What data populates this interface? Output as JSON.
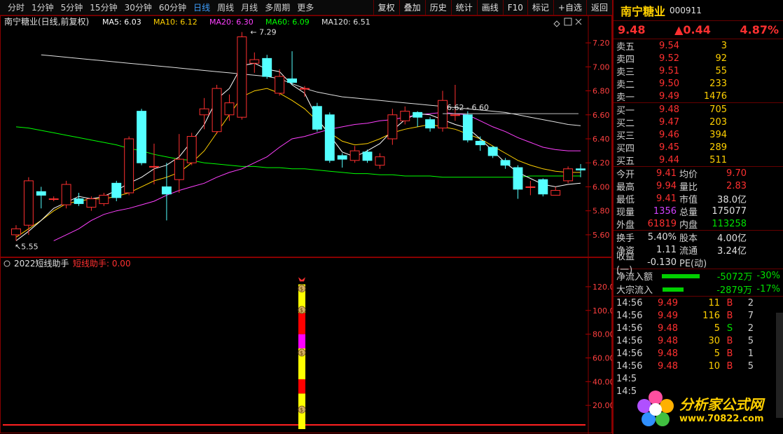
{
  "toolbar": {
    "periods": [
      "分时",
      "1分钟",
      "5分钟",
      "15分钟",
      "30分钟",
      "60分钟",
      "日线",
      "周线",
      "月线",
      "多周期",
      "更多"
    ],
    "active_period": "日线",
    "buttons": [
      "复权",
      "叠加",
      "历史",
      "统计",
      "画线",
      "F10",
      "标记",
      "+自选",
      "返回"
    ]
  },
  "main_chart": {
    "title": "南宁糖业(日线,前复权)",
    "ma_labels": [
      "MA5: 6.03",
      "MA10: 6.12",
      "MA20: 6.30",
      "MA60: 6.09",
      "MA120: 6.51"
    ],
    "ma_colors": [
      "#ffffff",
      "#ffd000",
      "#ff40ff",
      "#00ff00",
      "#e0e0e0"
    ],
    "high_label": "7.29",
    "low_label": "5.55",
    "range_label": "6.62 - 6.60",
    "y_ticks": [
      "7.20",
      "7.00",
      "6.80",
      "6.60",
      "6.40",
      "6.20",
      "6.00",
      "5.80",
      "5.60"
    ]
  },
  "sub_chart": {
    "title": "2022短线助手",
    "indicator": "短线助手: 0.00",
    "y_ticks": [
      "120.00",
      "100.00",
      "80.00",
      "60.00",
      "40.00",
      "20.00"
    ]
  },
  "chart_data": {
    "type": "candlestick",
    "ylim": [
      5.5,
      7.3
    ],
    "candles": [
      {
        "o": 5.6,
        "c": 5.65,
        "h": 5.68,
        "l": 5.55
      },
      {
        "o": 5.68,
        "c": 6.05,
        "h": 6.08,
        "l": 5.6
      },
      {
        "o": 5.96,
        "c": 5.93,
        "h": 6.0,
        "l": 5.82
      },
      {
        "o": 5.9,
        "c": 5.9,
        "h": 5.92,
        "l": 5.88
      },
      {
        "o": 5.85,
        "c": 6.02,
        "h": 6.05,
        "l": 5.82
      },
      {
        "o": 5.9,
        "c": 5.86,
        "h": 5.95,
        "l": 5.84
      },
      {
        "o": 5.83,
        "c": 5.9,
        "h": 5.92,
        "l": 5.8
      },
      {
        "o": 5.86,
        "c": 5.93,
        "h": 5.95,
        "l": 5.84
      },
      {
        "o": 6.03,
        "c": 5.91,
        "h": 6.05,
        "l": 5.88
      },
      {
        "o": 5.95,
        "c": 6.4,
        "h": 6.42,
        "l": 5.93
      },
      {
        "o": 6.63,
        "c": 6.2,
        "h": 6.65,
        "l": 6.18
      },
      {
        "o": 6.17,
        "c": 6.17,
        "h": 6.36,
        "l": 6.02
      },
      {
        "o": 6.0,
        "c": 5.94,
        "h": 6.2,
        "l": 5.72
      },
      {
        "o": 6.06,
        "c": 6.23,
        "h": 6.44,
        "l": 5.95
      },
      {
        "o": 6.2,
        "c": 6.42,
        "h": 6.45,
        "l": 6.18
      },
      {
        "o": 6.6,
        "c": 6.65,
        "h": 6.74,
        "l": 6.48
      },
      {
        "o": 6.46,
        "c": 6.82,
        "h": 6.85,
        "l": 6.44
      },
      {
        "o": 6.6,
        "c": 6.7,
        "h": 6.77,
        "l": 6.55
      },
      {
        "o": 6.58,
        "c": 7.25,
        "h": 7.29,
        "l": 6.56
      },
      {
        "o": 7.03,
        "c": 7.06,
        "h": 7.12,
        "l": 6.95
      },
      {
        "o": 7.07,
        "c": 6.92,
        "h": 7.1,
        "l": 6.9
      },
      {
        "o": 6.78,
        "c": 6.92,
        "h": 6.98,
        "l": 6.76
      },
      {
        "o": 6.9,
        "c": 6.87,
        "h": 7.13,
        "l": 6.85
      },
      {
        "o": 6.82,
        "c": 6.82,
        "h": 6.84,
        "l": 6.75
      },
      {
        "o": 6.67,
        "c": 6.48,
        "h": 6.7,
        "l": 6.46
      },
      {
        "o": 6.6,
        "c": 6.22,
        "h": 6.62,
        "l": 6.2
      },
      {
        "o": 6.26,
        "c": 6.23,
        "h": 6.28,
        "l": 6.16
      },
      {
        "o": 6.22,
        "c": 6.3,
        "h": 6.34,
        "l": 6.2
      },
      {
        "o": 6.29,
        "c": 6.22,
        "h": 6.31,
        "l": 6.2
      },
      {
        "o": 6.18,
        "c": 6.25,
        "h": 6.28,
        "l": 6.15
      },
      {
        "o": 6.4,
        "c": 6.6,
        "h": 6.65,
        "l": 6.35
      },
      {
        "o": 6.55,
        "c": 6.63,
        "h": 6.67,
        "l": 6.52
      },
      {
        "o": 6.62,
        "c": 6.58,
        "h": 6.63,
        "l": 6.5
      },
      {
        "o": 6.56,
        "c": 6.49,
        "h": 6.58,
        "l": 6.46
      },
      {
        "o": 6.49,
        "c": 6.72,
        "h": 6.8,
        "l": 6.46
      },
      {
        "o": 6.6,
        "c": 6.6,
        "h": 6.85,
        "l": 6.55
      },
      {
        "o": 6.6,
        "c": 6.39,
        "h": 6.63,
        "l": 6.37
      },
      {
        "o": 6.38,
        "c": 6.35,
        "h": 6.42,
        "l": 6.3
      },
      {
        "o": 6.33,
        "c": 6.26,
        "h": 6.34,
        "l": 6.24
      },
      {
        "o": 6.22,
        "c": 6.18,
        "h": 6.24,
        "l": 6.15
      },
      {
        "o": 6.16,
        "c": 5.98,
        "h": 6.18,
        "l": 5.9
      },
      {
        "o": 6.0,
        "c": 6.0,
        "h": 6.05,
        "l": 5.93
      },
      {
        "o": 6.06,
        "c": 5.94,
        "h": 6.07,
        "l": 5.92
      },
      {
        "o": 5.93,
        "c": 5.97,
        "h": 6.0,
        "l": 5.93
      },
      {
        "o": 6.05,
        "c": 6.15,
        "h": 6.17,
        "l": 6.03
      },
      {
        "o": 6.15,
        "c": 6.14,
        "h": 6.19,
        "l": 6.08
      }
    ],
    "ma5": [
      5.55,
      5.63,
      5.72,
      5.82,
      5.87,
      5.92,
      5.9,
      5.92,
      5.97,
      6.03,
      6.08,
      6.15,
      6.18,
      6.25,
      6.38,
      6.52,
      6.73,
      6.82,
      7.01,
      7.03,
      6.98,
      6.96,
      6.85,
      6.78,
      6.57,
      6.43,
      6.29,
      6.25,
      6.3,
      6.36,
      6.47,
      6.56,
      6.61,
      6.6,
      6.56,
      6.52,
      6.49,
      6.4,
      6.3,
      6.2,
      6.12,
      6.07,
      6.02,
      6.0,
      6.02,
      6.03
    ],
    "ma10": [
      5.58,
      5.65,
      5.72,
      5.8,
      5.86,
      5.88,
      5.9,
      5.9,
      5.92,
      5.95,
      6.0,
      6.05,
      6.08,
      6.12,
      6.2,
      6.3,
      6.45,
      6.6,
      6.75,
      6.8,
      6.82,
      6.78,
      6.72,
      6.65,
      6.55,
      6.45,
      6.38,
      6.35,
      6.36,
      6.4,
      6.45,
      6.48,
      6.5,
      6.52,
      6.5,
      6.48,
      6.44,
      6.4,
      6.34,
      6.28,
      6.22,
      6.18,
      6.15,
      6.13,
      6.12,
      6.12
    ],
    "ma20": [
      5.55,
      5.6,
      5.65,
      5.72,
      5.77,
      5.8,
      5.82,
      5.85,
      5.88,
      5.93,
      5.97,
      6.0,
      6.03,
      6.08,
      6.12,
      6.15,
      6.2,
      6.25,
      6.33,
      6.4,
      6.42,
      6.45,
      6.48,
      6.5,
      6.52,
      6.53,
      6.55,
      6.56,
      6.58,
      6.6,
      6.61,
      6.62,
      6.61,
      6.6,
      6.55,
      6.5,
      6.46,
      6.41,
      6.37,
      6.33,
      6.31,
      6.3,
      6.3
    ],
    "ma60": [
      6.5,
      6.49,
      6.47,
      6.45,
      6.43,
      6.41,
      6.39,
      6.37,
      6.35,
      6.32,
      6.3,
      6.27,
      6.25,
      6.23,
      6.22,
      6.2,
      6.19,
      6.18,
      6.17,
      6.17,
      6.16,
      6.16,
      6.15,
      6.15,
      6.14,
      6.13,
      6.12,
      6.11,
      6.11,
      6.1,
      6.1,
      6.09,
      6.09,
      6.09,
      6.08,
      6.08,
      6.08,
      6.08,
      6.08,
      6.08,
      6.08,
      6.09,
      6.09,
      6.09,
      6.09,
      6.09
    ],
    "ma120": [
      7.1,
      7.09,
      7.08,
      7.07,
      7.06,
      7.05,
      7.04,
      7.03,
      7.02,
      7.01,
      7.0,
      6.99,
      6.98,
      6.97,
      6.96,
      6.95,
      6.94,
      6.93,
      6.92,
      6.9,
      6.86,
      6.82,
      6.79,
      6.77,
      6.75,
      6.74,
      6.73,
      6.72,
      6.71,
      6.7,
      6.69,
      6.68,
      6.67,
      6.66,
      6.65,
      6.64,
      6.63,
      6.62,
      6.6,
      6.58,
      6.56,
      6.54,
      6.52,
      6.51
    ],
    "indicator_segments": [
      {
        "color": "#ffff00",
        "from": 0,
        "to": 30
      },
      {
        "color": "#ff0000",
        "from": 30,
        "to": 42
      },
      {
        "color": "#ffff00",
        "from": 42,
        "to": 68
      },
      {
        "color": "#ff00ff",
        "from": 68,
        "to": 80
      },
      {
        "color": "#ff0000",
        "from": 80,
        "to": 98
      },
      {
        "color": "#ffff00",
        "from": 98,
        "to": 122
      }
    ]
  },
  "stock": {
    "name": "南宁糖业",
    "code": "000911",
    "price": "9.48",
    "change": "▲0.44",
    "pct": "4.87%"
  },
  "orderbook": {
    "asks": [
      {
        "label": "卖五",
        "price": "9.54",
        "vol": "3"
      },
      {
        "label": "卖四",
        "price": "9.52",
        "vol": "92"
      },
      {
        "label": "卖三",
        "price": "9.51",
        "vol": "55"
      },
      {
        "label": "卖二",
        "price": "9.50",
        "vol": "233"
      },
      {
        "label": "卖一",
        "price": "9.49",
        "vol": "1476"
      }
    ],
    "bids": [
      {
        "label": "买一",
        "price": "9.48",
        "vol": "705"
      },
      {
        "label": "买二",
        "price": "9.47",
        "vol": "203"
      },
      {
        "label": "买三",
        "price": "9.46",
        "vol": "394"
      },
      {
        "label": "买四",
        "price": "9.45",
        "vol": "289"
      },
      {
        "label": "买五",
        "price": "9.44",
        "vol": "511"
      }
    ]
  },
  "stats": [
    {
      "l1": "今开",
      "v1": "9.41",
      "c1": "red",
      "l2": "均价",
      "v2": "9.70",
      "c2": "red"
    },
    {
      "l1": "最高",
      "v1": "9.94",
      "c1": "red",
      "l2": "量比",
      "v2": "2.83",
      "c2": "red"
    },
    {
      "l1": "最低",
      "v1": "9.41",
      "c1": "red",
      "l2": "市值",
      "v2": "38.0亿",
      "c2": "white"
    },
    {
      "l1": "现量",
      "v1": "1356",
      "c1": "purple",
      "l2": "总量",
      "v2": "175077",
      "c2": "white"
    },
    {
      "l1": "外盘",
      "v1": "61819",
      "c1": "red",
      "l2": "内盘",
      "v2": "113258",
      "c2": "green"
    }
  ],
  "stats2": [
    {
      "l1": "换手",
      "v1": "5.40%",
      "c1": "white",
      "l2": "股本",
      "v2": "4.00亿",
      "c2": "white"
    },
    {
      "l1": "净资",
      "v1": "1.11",
      "c1": "white",
      "l2": "流通",
      "v2": "3.24亿",
      "c2": "white"
    },
    {
      "l1": "收益(一)",
      "v1": "-0.130",
      "c1": "white",
      "l2": "PE(动)",
      "v2": "",
      "c2": "white"
    }
  ],
  "flows": [
    {
      "label": "净流入额",
      "value": "-5072万",
      "pct": "-30%",
      "bar": 0.55
    },
    {
      "label": "大宗流入",
      "value": "-2879万",
      "pct": "-17%",
      "bar": 0.3
    }
  ],
  "ticks": [
    {
      "t": "14:56",
      "p": "9.49",
      "v": "11",
      "bs": "B",
      "bsc": "red",
      "x": "2"
    },
    {
      "t": "14:56",
      "p": "9.49",
      "v": "116",
      "bs": "B",
      "bsc": "red",
      "x": "7"
    },
    {
      "t": "14:56",
      "p": "9.48",
      "v": "5",
      "bs": "S",
      "bsc": "green",
      "x": "2"
    },
    {
      "t": "14:56",
      "p": "9.48",
      "v": "30",
      "bs": "B",
      "bsc": "red",
      "x": "5"
    },
    {
      "t": "14:56",
      "p": "9.48",
      "v": "5",
      "bs": "B",
      "bsc": "red",
      "x": "1"
    },
    {
      "t": "14:56",
      "p": "9.48",
      "v": "10",
      "bs": "B",
      "bsc": "red",
      "x": "5"
    },
    {
      "t": "14:5",
      "p": "",
      "v": "",
      "bs": "",
      "bsc": "red",
      "x": ""
    },
    {
      "t": "14:5",
      "p": "",
      "v": "",
      "bs": "",
      "bsc": "red",
      "x": ""
    }
  ],
  "logo": {
    "title": "分析家公式网",
    "url": "www.70822.com"
  }
}
